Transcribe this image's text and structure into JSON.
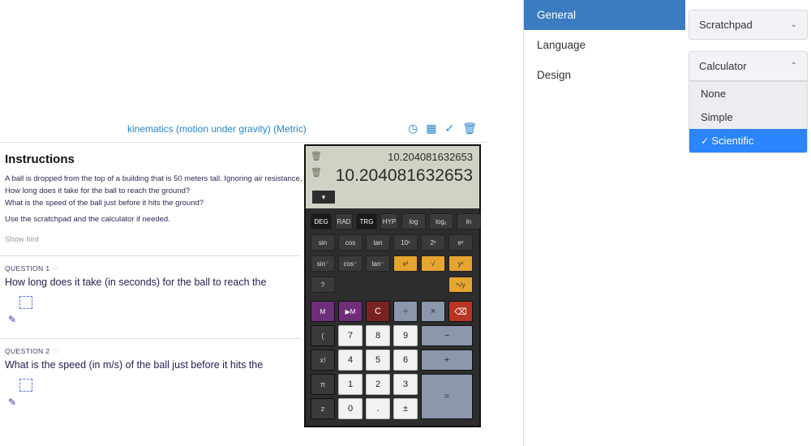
{
  "quiz": {
    "link_text": "kinematics (motion under gravity) (Metric)",
    "instructions_heading": "Instructions",
    "scenario": "A ball is dropped from the top of a building that is 50 meters tall. Ignoring air resistance,",
    "q_a": "How long does it take for the ball to reach the ground?",
    "q_b": "What is the speed of the ball just before it hits the ground?",
    "hint_instr": "Use the scratchpad and the calculator if needed.",
    "show_hint": "Show hint",
    "question1": {
      "label": "QUESTION 1",
      "text": "How long does it take (in seconds) for the ball to reach the"
    },
    "question2": {
      "label": "QUESTION 2",
      "text": "What is the speed (in m/s) of the ball just before it hits the"
    }
  },
  "calculator": {
    "line1": "10.204081632653",
    "line2": "10.204081632653",
    "mode_row": [
      "DEG",
      "RAD",
      "TRG",
      "HYP",
      "log",
      "log₂",
      "ln"
    ],
    "row_a": [
      "sin",
      "cos",
      "tan",
      "10ˣ",
      "2ˣ",
      "eˣ"
    ],
    "row_b": [
      "sin⁻",
      "cos⁻",
      "tan⁻",
      "x²",
      "√",
      "yˣ"
    ],
    "row_c": [
      "?",
      "",
      "",
      "",
      "",
      "ˣ√y"
    ],
    "mainrows": [
      [
        "M",
        "▶M",
        "C",
        "÷",
        "×",
        "⌫"
      ],
      [
        "(",
        "7",
        "8",
        "9",
        "−"
      ],
      [
        "x!",
        "4",
        "5",
        "6",
        "+"
      ],
      [
        "π",
        "1",
        "2",
        "3",
        "="
      ],
      [
        "z",
        "0",
        ".",
        "±"
      ]
    ]
  },
  "sidebar": {
    "tabs": [
      "General",
      "Language",
      "Design"
    ]
  },
  "panels": {
    "scratchpad_label": "Scratchpad",
    "calculator_label": "Calculator",
    "options": [
      "None",
      "Simple",
      "Scientific"
    ]
  }
}
